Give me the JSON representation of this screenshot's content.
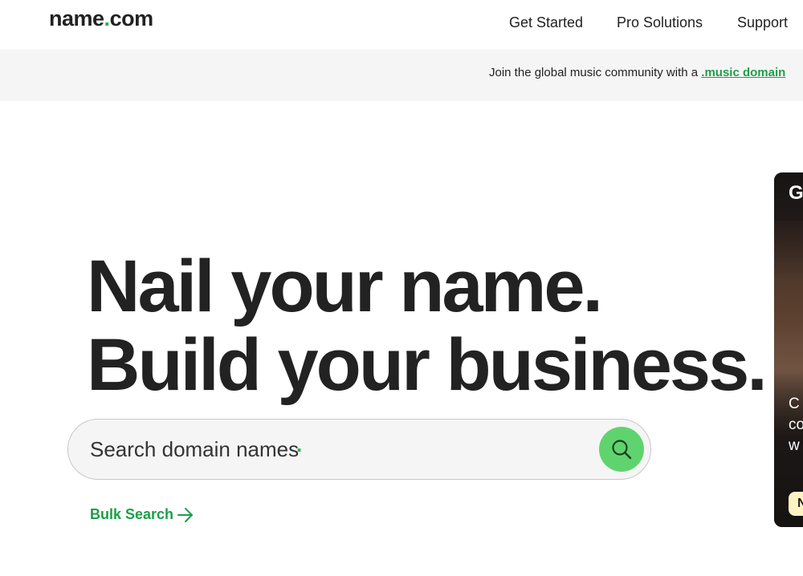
{
  "header": {
    "logo_left": "name",
    "logo_dot": ".",
    "logo_right": "com",
    "nav": [
      "Get Started",
      "Pro Solutions",
      "Support"
    ]
  },
  "banner": {
    "text": "Join the global music community with a ",
    "link": ".music domain"
  },
  "hero": {
    "line1": "Nail your name.",
    "line2": "Build your business."
  },
  "search": {
    "placeholder": "Search domain names",
    "dot": "."
  },
  "bulk_search": {
    "label": "Bulk Search"
  },
  "side_card": {
    "title": "G",
    "body": [
      "C",
      "co",
      "w"
    ],
    "button": "N"
  },
  "colors": {
    "accent": "#2bb24c",
    "accent_link": "#1d9e48",
    "search_button": "#5fd46e",
    "text": "#222222",
    "banner_bg": "#f5f5f5"
  },
  "icons": {
    "search_button": "search-icon",
    "bulk_search": "arrow-right-icon"
  }
}
